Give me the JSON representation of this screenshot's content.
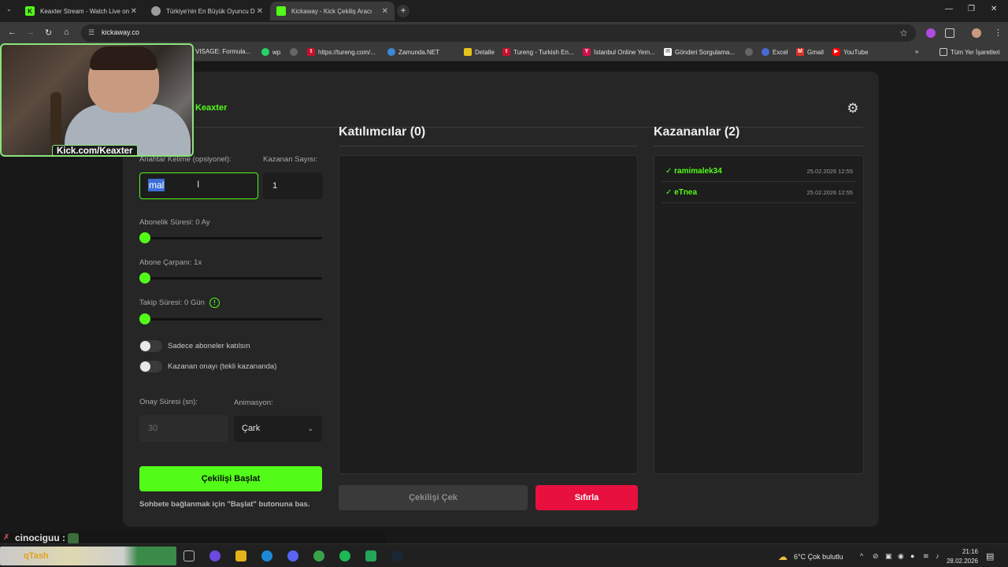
{
  "browser": {
    "tabs": [
      {
        "label": "Keaxter Stream - Watch Live on",
        "favicon": "kick-favicon",
        "color": "#53fc18",
        "fav_text": "K"
      },
      {
        "label": "Türkiye'nin En Büyük Oyuncu D",
        "favicon": "globe-favicon",
        "color": "#9c9c9c",
        "fav_text": "⚙"
      },
      {
        "label": "Kickaway - Kick Çekiliş Aracı",
        "favicon": "kickaway-favicon",
        "color": "#53fc18",
        "fav_text": "■"
      }
    ],
    "new_tab": "+",
    "url": "kickaway.co",
    "bookmarks": [
      {
        "label": "VISAGE: Formula...",
        "icon": "visage-icon",
        "color": "#555555"
      },
      {
        "label": "wp",
        "icon": "whatsapp-icon",
        "color": "#25d366"
      },
      {
        "label": "",
        "icon": "globe-icon",
        "color": "#666666"
      },
      {
        "label": "https://tureng.com/...",
        "icon": "tureng-icon",
        "color": "#c8102e"
      },
      {
        "label": "Zamunda.NET",
        "icon": "zamunda-icon",
        "color": "#3a8ad6"
      },
      {
        "label": "Detalle",
        "icon": "detalle-icon",
        "color": "#e6c21c"
      },
      {
        "label": "Tureng - Turkish En...",
        "icon": "tureng-icon",
        "color": "#c8102e"
      },
      {
        "label": "İstanbul Online Yem...",
        "icon": "yemek-icon",
        "color": "#d0104a"
      },
      {
        "label": "Gönderi Sorgulama...",
        "icon": "mail-icon",
        "color": "#ffffff"
      },
      {
        "label": "",
        "icon": "globe-icon",
        "color": "#666666"
      },
      {
        "label": "Excel",
        "icon": "excel-icon",
        "color": "#4a6ad6"
      },
      {
        "label": "Gmail",
        "icon": "gmail-icon",
        "color": "#d93025"
      },
      {
        "label": "YouTube",
        "icon": "youtube-icon",
        "color": "#ff0000"
      }
    ],
    "bookmarks_more": "»",
    "all_bookmarks": "Tüm Yer İşaretleri"
  },
  "app": {
    "brand": "Keaxter",
    "settings_icon": "gear-icon",
    "keyword_label": "Anahtar Kelime (opsiyonel):",
    "keyword_value": "mal",
    "winner_count_label": "Kazanan Sayısı:",
    "winner_count_value": "1",
    "subscription_label": "Abonelik Süresi: 0 Ay",
    "subscription_level": 0,
    "multiplier_label": "Abone Çarpanı: 1x",
    "multiplier_level": 0,
    "follow_label": "Takip Süresi: 0 Gün",
    "follow_level": 0,
    "info_icon": "!",
    "toggle_subs_label": "Sadece aboneler katılsın",
    "toggle_subs_on": false,
    "toggle_confirm_label": "Kazanan onayı (tekli kazananda)",
    "toggle_confirm_on": false,
    "confirm_time_label": "Onay Süresi (sn):",
    "confirm_time_value": "30",
    "animation_label": "Animasyon:",
    "animation_value": "Çark",
    "start_button": "Çekilişi Başlat",
    "hint": "Sohbete bağlanmak için \"Başlat\" butonuna bas.",
    "participants_title": "Katılımcılar (0)",
    "winners_title": "Kazananlar (2)",
    "winners": [
      {
        "name": "✓ ramimalek34",
        "time": "25.02.2026 12:55"
      },
      {
        "name": "✓ eTnea",
        "time": "25.02.2026 12:55"
      }
    ],
    "draw_button": "Çekilişi Çek",
    "reset_button": "Sıfırla",
    "accent": "#53fc18",
    "danger": "#e8103f"
  },
  "overlay": {
    "webcam_tag": "Kick.com/Keaxter",
    "chat_line": "cinociguu :",
    "taskbar_label": "qTash"
  },
  "taskbar": {
    "weather": "6°C  Çok bulutlu",
    "time": "21:16",
    "date": "28.02.2026"
  }
}
